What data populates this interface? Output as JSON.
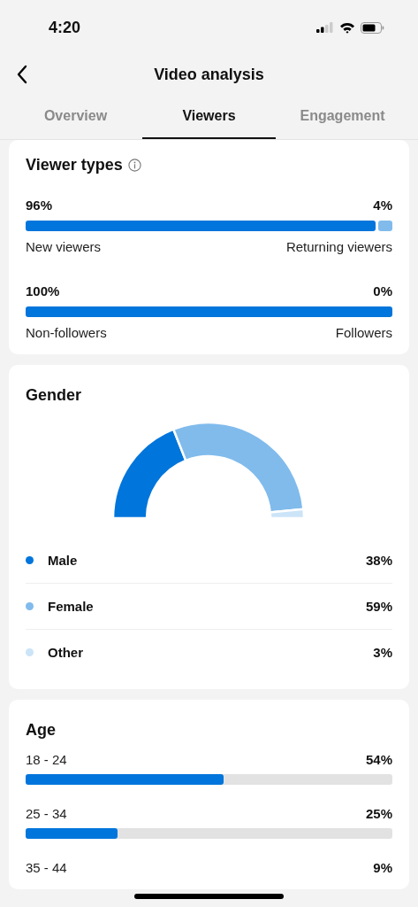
{
  "status_bar": {
    "time": "4:20"
  },
  "header": {
    "title": "Video analysis"
  },
  "tabs": [
    {
      "label": "Overview",
      "selected": false
    },
    {
      "label": "Viewers",
      "selected": true
    },
    {
      "label": "Engagement",
      "selected": false
    }
  ],
  "viewer_types": {
    "title": "Viewer types",
    "rows": [
      {
        "left_value": "96%",
        "right_value": "4%",
        "left_label": "New viewers",
        "right_label": "Returning viewers"
      },
      {
        "left_value": "100%",
        "right_value": "0%",
        "left_label": "Non-followers",
        "right_label": "Followers"
      }
    ]
  },
  "gender": {
    "title": "Gender",
    "legend": [
      {
        "label": "Male",
        "value": "38%",
        "color": "#0075db"
      },
      {
        "label": "Female",
        "value": "59%",
        "color": "#80bbec"
      },
      {
        "label": "Other",
        "value": "3%",
        "color": "#cce4f8"
      }
    ]
  },
  "age": {
    "title": "Age",
    "rows": [
      {
        "label": "18 - 24",
        "value": "54%",
        "level": 0.54
      },
      {
        "label": "25 - 34",
        "value": "25%",
        "level": 0.25
      },
      {
        "label": "35 - 44",
        "value": "9%"
      }
    ]
  }
}
